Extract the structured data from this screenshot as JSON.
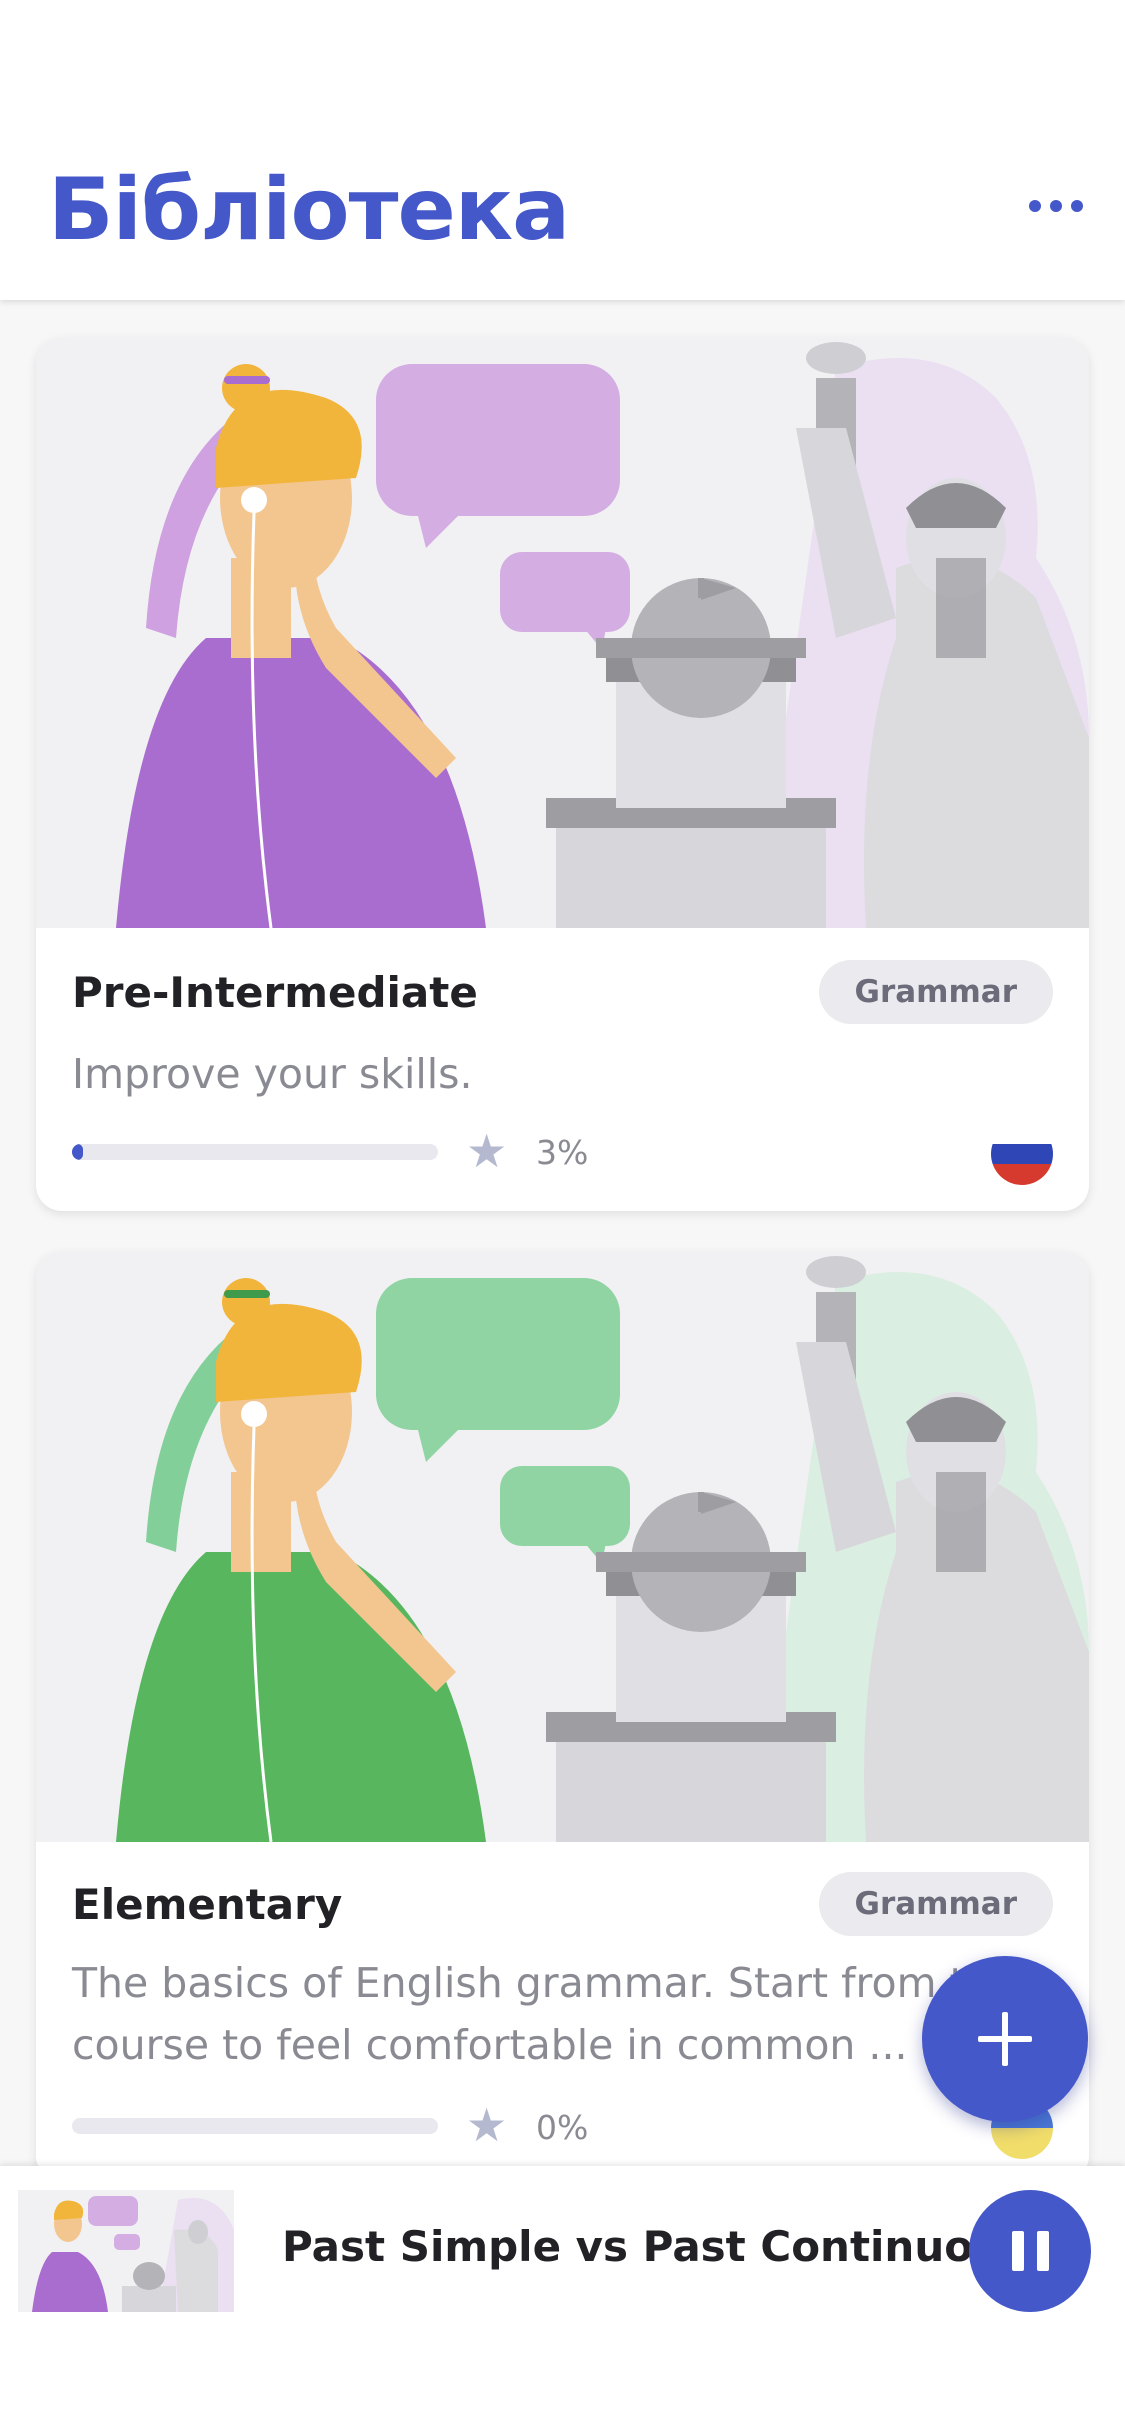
{
  "header": {
    "title": "Бібліотека",
    "menu_icon": "more-horizontal-icon"
  },
  "colors": {
    "accent": "#4458c9",
    "purple": "#a96dd0",
    "green": "#57b65e"
  },
  "courses": [
    {
      "title": "Pre-Intermediate",
      "tag": "Grammar",
      "description": "Improve your skills.",
      "progress": 0.03,
      "progress_text": "3%",
      "flag": "russia-flag-icon",
      "theme": "purple"
    },
    {
      "title": "Elementary",
      "tag": "Grammar",
      "description": "The basics of English grammar. Start from this course to feel comfortable in common ...",
      "progress": 0.0,
      "progress_text": "0%",
      "flag": "ukraine-flag-icon",
      "theme": "green"
    }
  ],
  "fab": {
    "icon": "plus-icon"
  },
  "player": {
    "title": "Past Simple vs Past Continuous",
    "icon": "pause-icon"
  }
}
